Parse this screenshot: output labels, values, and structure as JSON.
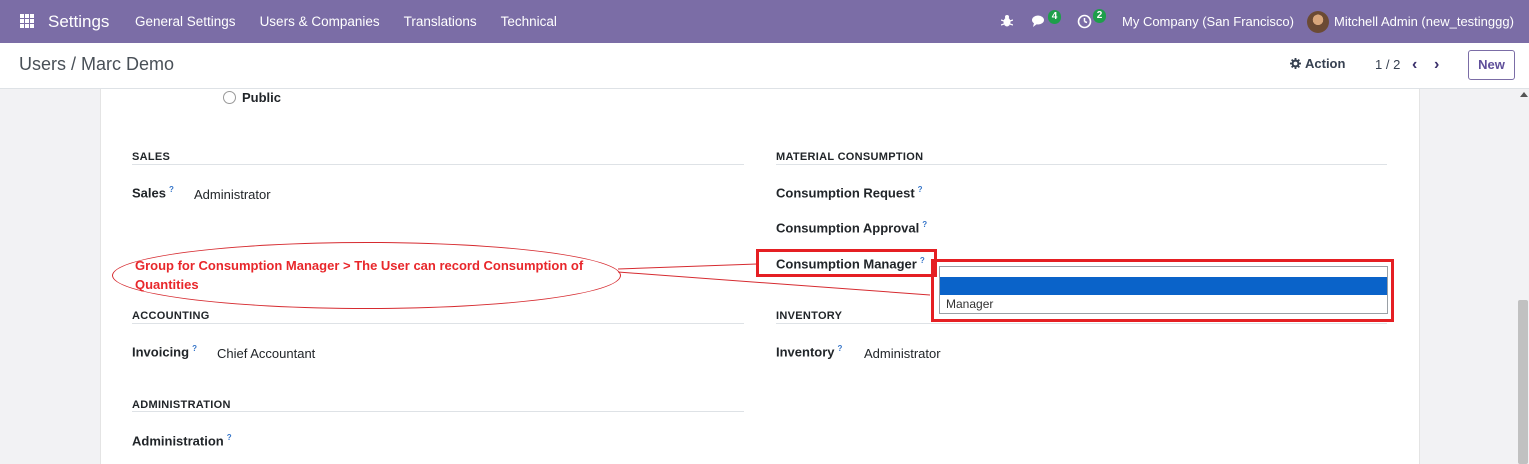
{
  "navbar": {
    "brand": "Settings",
    "menu": [
      "General Settings",
      "Users & Companies",
      "Translations",
      "Technical"
    ],
    "chat_badge": "4",
    "activity_badge": "2",
    "company": "My Company (San Francisco)",
    "user": "Mitchell Admin (new_testinggg)"
  },
  "control": {
    "breadcrumb": "Users / Marc Demo",
    "action_label": "Action",
    "pager": "1 / 2",
    "new_label": "New"
  },
  "form": {
    "radio_public": "Public",
    "sales": {
      "title": "SALES",
      "label": "Sales",
      "value": "Administrator"
    },
    "material": {
      "title": "MATERIAL CONSUMPTION",
      "request": "Consumption Request",
      "approval": "Consumption Approval",
      "manager": "Consumption Manager"
    },
    "accounting": {
      "title": "ACCOUNTING",
      "label": "Invoicing",
      "value": "Chief Accountant"
    },
    "inventory": {
      "title": "INVENTORY",
      "label": "Inventory",
      "value": "Administrator"
    },
    "administration": {
      "title": "ADMINISTRATION",
      "label": "Administration"
    },
    "help_mark": "?"
  },
  "dropdown": {
    "options": [
      "",
      "Manager"
    ],
    "highlighted_index": 0
  },
  "annotation": {
    "text": "Group for Consumption Manager > The User can record Consumption of Quantities",
    "color": "#e51f23"
  }
}
